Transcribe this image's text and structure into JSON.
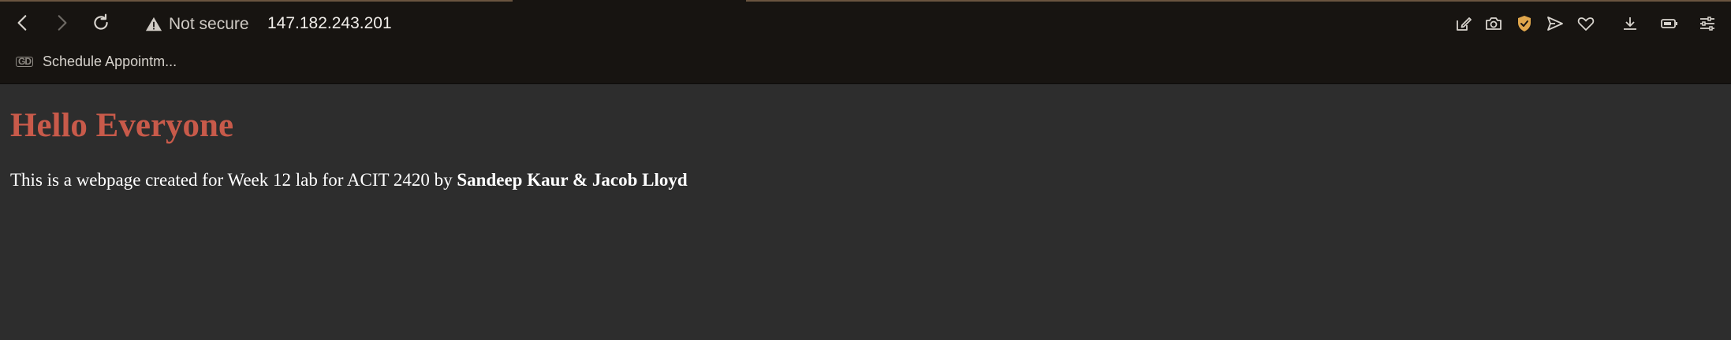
{
  "browser": {
    "security_label": "Not secure",
    "url": "147.182.243.201",
    "nav_icons": [
      "back-icon",
      "forward-icon",
      "reload-icon"
    ],
    "toolbar_icons": [
      "edit-icon",
      "screenshot-icon",
      "shield-icon",
      "send-icon",
      "heart-icon",
      "download-icon",
      "battery-icon",
      "settings-icon"
    ],
    "accent_color": "#e0a64c"
  },
  "bookmarks_bar": {
    "items": [
      {
        "label": "Schedule Appointm...",
        "icon": "gd-icon"
      }
    ]
  },
  "page": {
    "heading": "Hello Everyone",
    "heading_color": "#c85a4a",
    "paragraph_prefix": "This is a webpage created for Week 12 lab for ACIT 2420 by ",
    "paragraph_authors": "Sandeep Kaur & Jacob Lloyd",
    "background_color": "#2d2d2d"
  }
}
